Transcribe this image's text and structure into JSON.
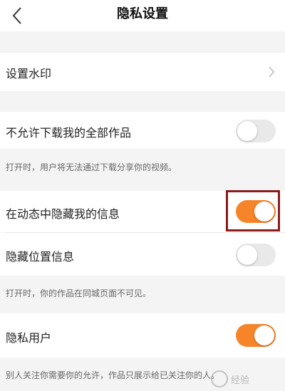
{
  "header": {
    "title": "隐私设置"
  },
  "rows": {
    "watermark": {
      "label": "设置水印"
    },
    "no_download": {
      "label": "不允许下载我的全部作品",
      "on": false,
      "note": "打开时，用户将无法通过下载分享你的视频。"
    },
    "hide_in_feed": {
      "label": "在动态中隐藏我的信息",
      "on": true
    },
    "hide_location": {
      "label": "隐藏位置信息",
      "on": false,
      "note": "打开时，你的作品在同城页面不可见。"
    },
    "private_user": {
      "label": "隐私用户",
      "on": true,
      "note": "别人关注你需要你的允许，作品只展示给已关注你的人。"
    }
  },
  "watermark_overlay": {
    "text": "经验"
  },
  "colors": {
    "toggle_on": "#f6852a",
    "highlight_box": "#8a1c1c"
  }
}
